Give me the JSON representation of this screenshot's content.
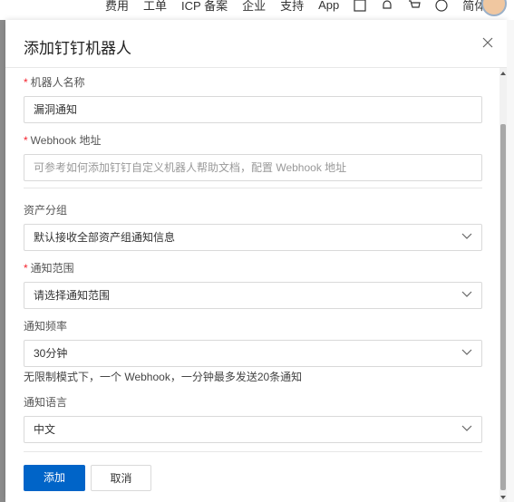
{
  "topbar": {
    "nav": [
      "费用",
      "工单",
      "ICP 备案",
      "企业",
      "支持",
      "App"
    ],
    "lang": "简体",
    "icons": [
      "message-icon",
      "bell-icon",
      "cart-icon",
      "help-icon"
    ]
  },
  "modal": {
    "title": "添加钉钉机器人",
    "fields": {
      "robot_name": {
        "required": "*",
        "label": "机器人名称",
        "value": "漏洞通知"
      },
      "webhook": {
        "required": "*",
        "label": "Webhook 地址",
        "placeholder": "可参考如何添加钉钉自定义机器人帮助文档，配置 Webhook 地址"
      },
      "asset_group": {
        "label": "资产分组",
        "value": "默认接收全部资产组通知信息"
      },
      "scope": {
        "required": "*",
        "label": "通知范围",
        "placeholder": "请选择通知范围"
      },
      "frequency": {
        "label": "通知频率",
        "value": "30分钟",
        "hint": "无限制模式下，一个 Webhook，一分钟最多发送20条通知"
      },
      "language": {
        "label": "通知语言",
        "value": "中文"
      }
    },
    "buttons": {
      "add": "添加",
      "cancel": "取消"
    }
  },
  "colors": {
    "primary": "#0064c8",
    "required": "#f5222d"
  }
}
